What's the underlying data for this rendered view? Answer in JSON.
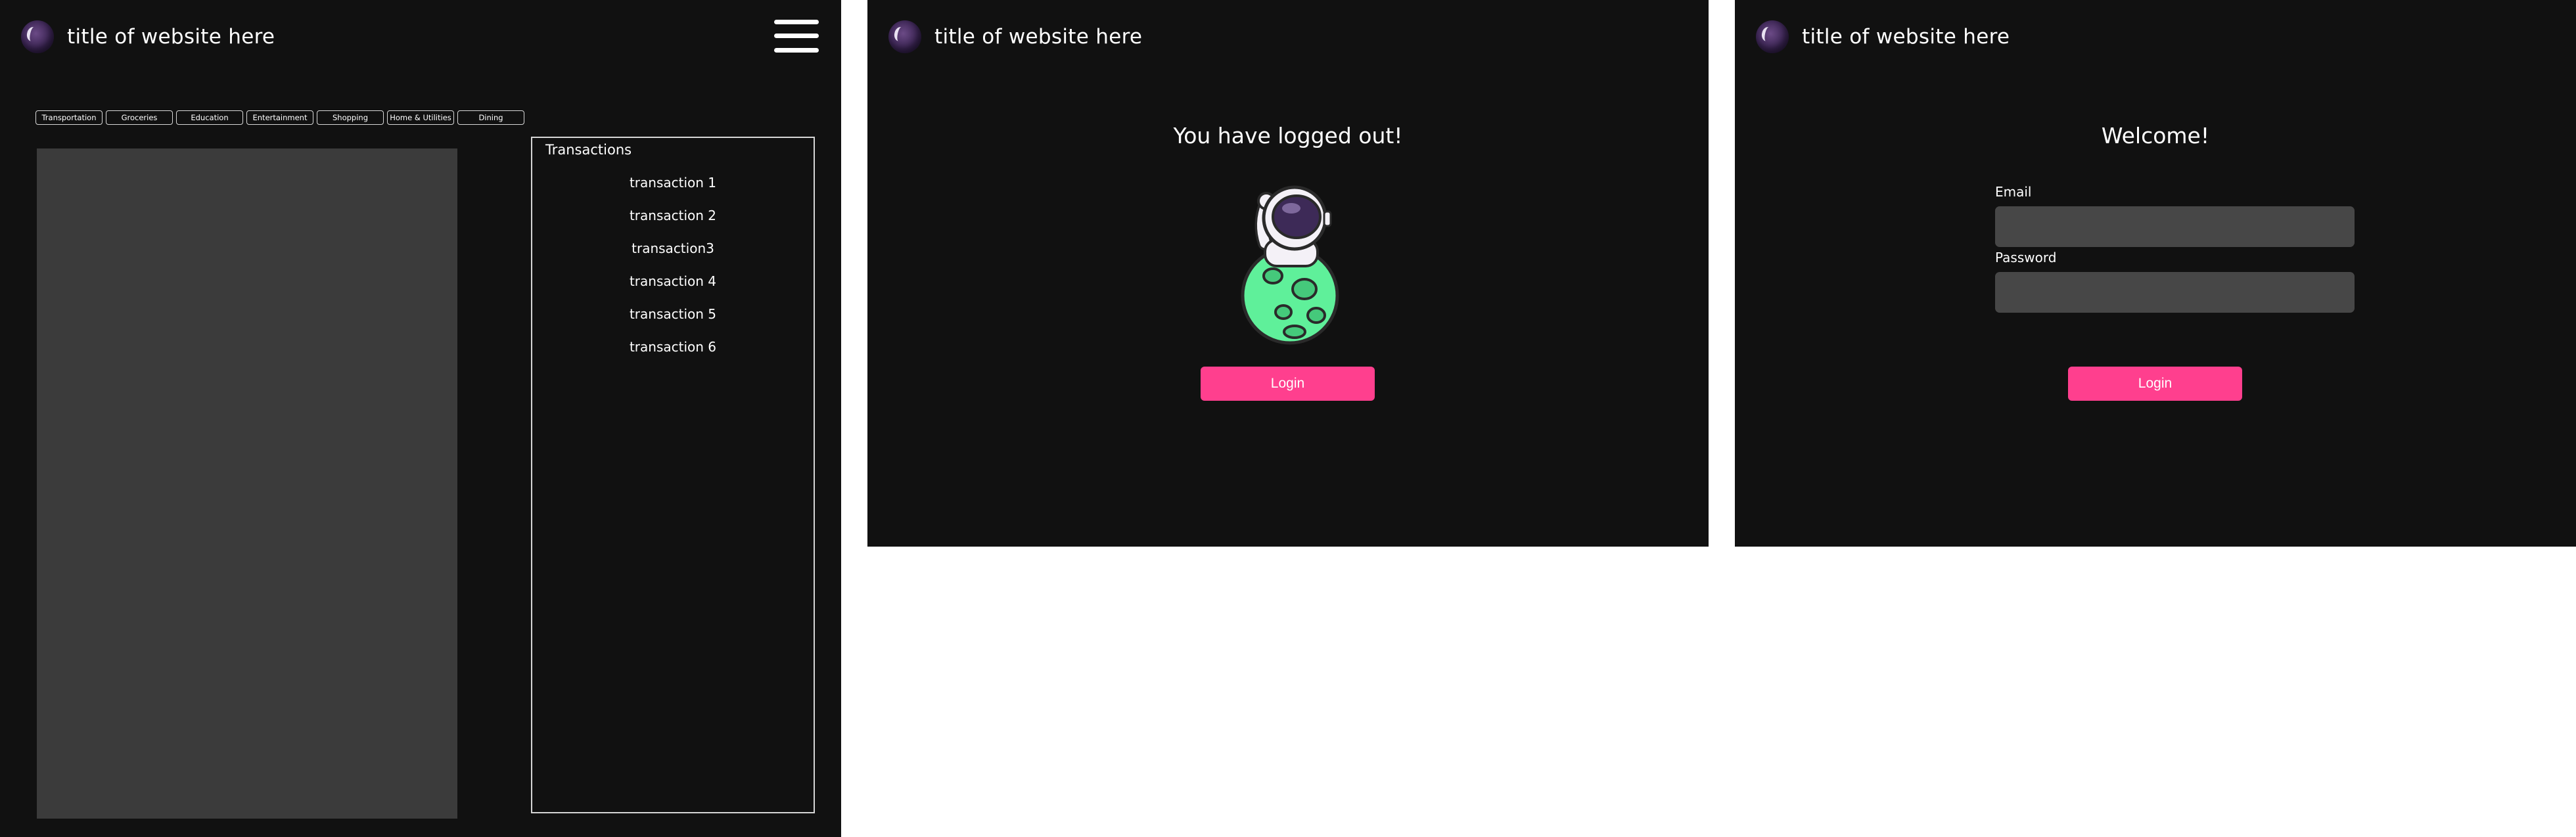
{
  "site": {
    "title": "title of website here"
  },
  "dashboard": {
    "categories": [
      "Transportation",
      "Groceries",
      "Education",
      "Entertainment",
      "Shopping",
      "Home & Utilities",
      "Dining"
    ],
    "transactions": {
      "title": "Transactions",
      "items": [
        "transaction 1",
        "transaction 2",
        "transaction3",
        "transaction 4",
        "transaction 5",
        "transaction 6"
      ]
    }
  },
  "logout": {
    "heading": "You have logged out!",
    "login_label": "Login"
  },
  "login": {
    "heading": "Welcome!",
    "email_label": "Email",
    "password_label": "Password",
    "login_label": "Login"
  },
  "colors": {
    "background": "#111111",
    "accent": "#ff3f8e",
    "panel": "#3b3b3b",
    "input": "#474747"
  },
  "icons": {
    "logo": "planet-logo-icon",
    "menu": "hamburger-menu-icon",
    "illustration": "astronaut-on-moon-illustration"
  }
}
